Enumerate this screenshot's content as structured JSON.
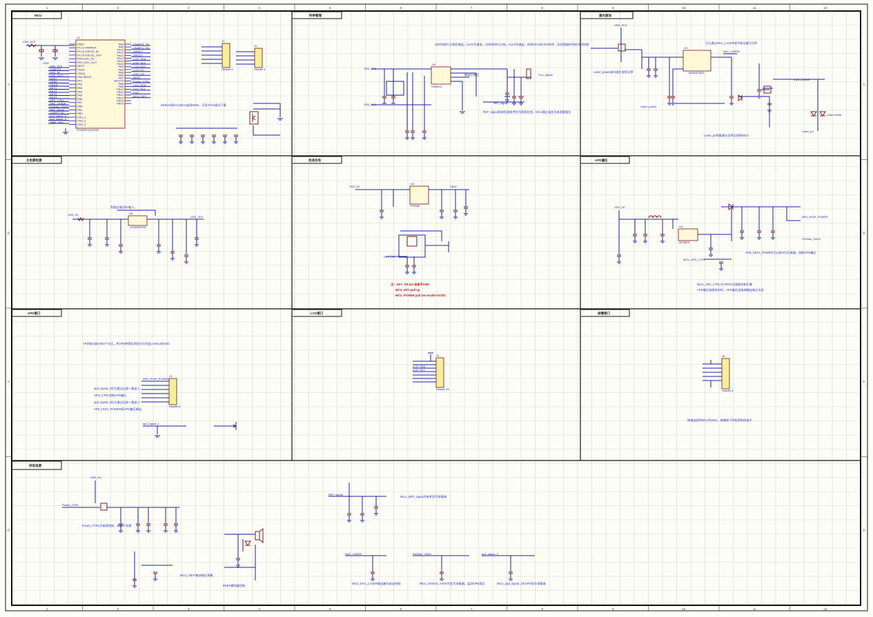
{
  "sheet": {
    "col_labels": [
      "1",
      "2",
      "3",
      "4",
      "5",
      "6",
      "7",
      "8",
      "9",
      "10",
      "11",
      "12"
    ],
    "row_labels": [
      "A",
      "B",
      "C",
      "D"
    ]
  },
  "sections": {
    "mcu": "MCU",
    "clock": "时钟管理",
    "laser": "激光驱动",
    "power_main": "主电源电源",
    "charge": "电池充电",
    "apd_bias": "APD偏压",
    "apd_if": "APD接口",
    "lcd_if": "LCD接口",
    "key_if": "按键接口",
    "aux_power": "供电电源"
  },
  "notes": {
    "mcu_debug": "DEBUG接口与MCU连接SWD，可用JTAG调试下载",
    "clock_desc": "对时钟进行分频后输出，CLK2为基准，对时钟进行分频，CLK3为输出，接到MCU的APD时序，实现两路时钟信号的控制",
    "clock_desc2": "输出分频后",
    "clock_desc3": "REF_signal用来检测参考信号的相位差，MCU通过该信号来测量相位",
    "laser_desc": "可以通过DAC_LASER调节驱动激光功率",
    "laser_desc2": "Laser_power调节激光发射功率",
    "laser_desc3": "Laser_pd采集激光功率反馈到MCU",
    "power_desc": "系统总电压5V输入",
    "charge_red1": "注：KEY_ON pin 低电平GND",
    "charge_red2": "MCU_KEY pull up",
    "charge_red3": "MCU_POWER pull low enable DC/DC",
    "apd_desc1": "APD_HIGH_POWER可以调节升压电路，控制APD偏压",
    "apd_desc2": "MCU_APD_CTRL为APD升压使能控制引脚",
    "apd_desc3": "APD偏压电源关闭时，APD偏压由电源输出电压决定",
    "apd_if_desc": "APD接口部分有2个分压，将APD转换后的信号分别送入MCU的ADC",
    "apd_if_n1": "apd_signal_1信号通过运放一路送入",
    "apd_if_n2": "APD_CTRL控制APD偏压",
    "apd_if_n3": "apd_signal_2信号通过运放一路送入",
    "apd_if_n4": "APD_HIGH_POWER接APD偏压输出",
    "key_desc": "按键连接到MCU的IO口，按键按下时检测到低电平",
    "aux_n1": "Power_CTRL为电源控制，高电平导通",
    "aux_n2": "MCU_VBAT电池电压采集",
    "aux_n3": "MCU_REF_signal为参考信号采集端",
    "aux_n4": "MCU_DAC_LASER输出激光驱动控制",
    "aux_n5": "MCU_SIGNAL_HIGH为信号采集端，监测APD高压",
    "aux_n6": "MCU_apd_signal_2为APD信号采集端",
    "aux_n7": "BEEP蜂鸣器控制"
  },
  "chips": {
    "mcu_ref": "U1",
    "mcu_part": "STM32F103C8T6",
    "clk_ref": "U5",
    "clk_part": "SI5351A",
    "laser_ref": "U3",
    "laser_part": "AD8031ARZ",
    "ldo_ref": "U6",
    "ldo_part": "XC6206P332",
    "chg_ref": "U2",
    "chg_part": "TP4056",
    "boost_ref": "U4",
    "boost_part": "MT3608",
    "lcd_ref": "J2",
    "lcd_part": "Header 10",
    "key_ref": "J6",
    "key_part": "Header 6",
    "swd_ref": "J1",
    "swd_part": "Header 5",
    "j3_ref": "J3",
    "j3_part": "Header 4",
    "apd_conn_ref": "J4",
    "apd_conn_part": "Header 6"
  },
  "nets": {
    "vdd33": "VDD_3V3",
    "vdd5": "VDD_5V",
    "vbat": "VBAT",
    "gnd": "GND",
    "laser_vdd": "VDD_LASER",
    "apd_hv": "APD_HIGH_POWER",
    "clk_out": "CLK_signal",
    "ref_sig": "REF_signal",
    "dac_laser": "DAC_LASER",
    "apd_ctrl": "MCU_APD_CTRL",
    "lcd_sda": "LCD_SDA",
    "lcd_scl": "LCD_SCL",
    "key_on": "KEY_ON",
    "power_ctrl": "Power_CTRL",
    "laser_diode": "Laser Diode",
    "laser_power": "Laser_power",
    "laser_pd": "Laser_pd",
    "apd_signal": "apd_signal_1",
    "apd_signal2": "apd_signal_2",
    "signal_high": "SIGNAL_HIGH"
  },
  "mcu_pins_left": [
    "VBAT",
    "PC13-TAMPER",
    "PC14-OSC32_IN",
    "PC15-OSC32_OUT",
    "PD0-OSC_IN",
    "PD1-OSC_OUT",
    "NRST",
    "VSSA",
    "VDDA",
    "PA0-WKUP",
    "PA1",
    "PA2",
    "PA3",
    "PA4",
    "PA5",
    "PA6",
    "PA7",
    "PB0",
    "PB1",
    "PB2",
    "VSS_1",
    "VSS_2",
    "VSS_3"
  ],
  "mcu_pins_right": [
    "PA8",
    "PA9",
    "PA10",
    "PA11",
    "PA12",
    "PA13",
    "PA14",
    "PA15",
    "PB3",
    "PB4",
    "PB5",
    "PB6",
    "PB7",
    "BOOT0",
    "PB8",
    "PB9",
    "PB10",
    "PB11",
    "PB12",
    "PB13",
    "PB14",
    "PB15"
  ],
  "mcu_left_nets": [
    "VDD_3V3",
    "TAMPER",
    "OSC_IN",
    "OSC_OUT",
    "NRST",
    "VSSA",
    "VDDA",
    "KEY1",
    "KEY2",
    "KEY3",
    "KEY4",
    "APD_CTRL",
    "DAC_LASER",
    "SIGNAL_HIGH",
    "REF_signal",
    "LASER_PD",
    "apd_signal_1",
    "apd_signal_2",
    "VBAT_ADC"
  ],
  "mcu_right_nets": [
    "USART1_TX",
    "USART1_RX",
    "SWDIO",
    "SWCLK",
    "LCD_SDA",
    "LCD_SCL",
    "LCD_RST",
    "LCD_DC",
    "LCD_CS",
    "BEEP",
    "Power_CTRL",
    "CLK_SDA",
    "CLK_SCL",
    "LED",
    "MCU_KEY"
  ]
}
